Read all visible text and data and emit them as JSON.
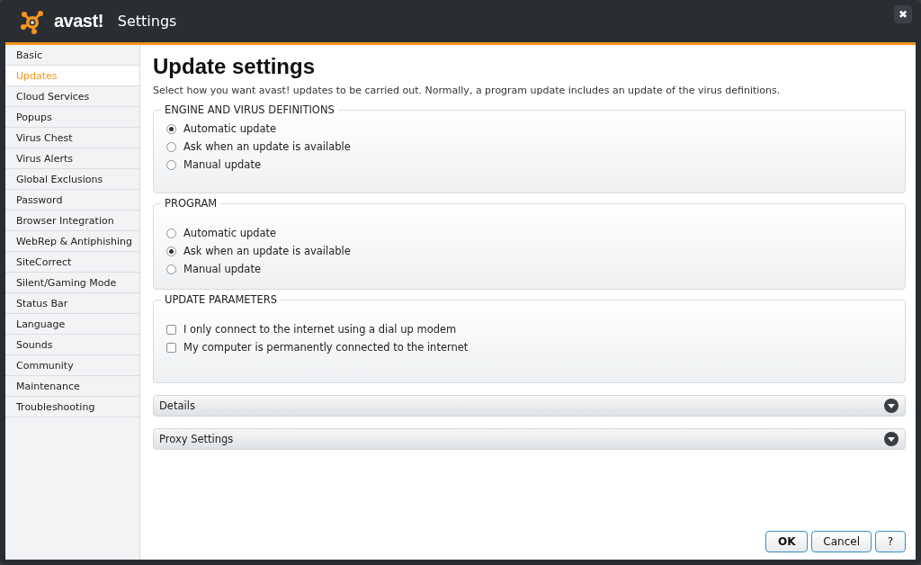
{
  "window": {
    "logo": "avast!",
    "title": "Settings",
    "close": "✖"
  },
  "sidebar": {
    "items": [
      {
        "label": "Basic",
        "selected": false
      },
      {
        "label": "Updates",
        "selected": true
      },
      {
        "label": "Cloud Services",
        "selected": false
      },
      {
        "label": "Popups",
        "selected": false
      },
      {
        "label": "Virus Chest",
        "selected": false
      },
      {
        "label": "Virus Alerts",
        "selected": false
      },
      {
        "label": "Global Exclusions",
        "selected": false
      },
      {
        "label": "Password",
        "selected": false
      },
      {
        "label": "Browser Integration",
        "selected": false
      },
      {
        "label": "WebRep & Antiphishing",
        "selected": false
      },
      {
        "label": "SiteCorrect",
        "selected": false
      },
      {
        "label": "Silent/Gaming Mode",
        "selected": false
      },
      {
        "label": "Status Bar",
        "selected": false
      },
      {
        "label": "Language",
        "selected": false
      },
      {
        "label": "Sounds",
        "selected": false
      },
      {
        "label": "Community",
        "selected": false
      },
      {
        "label": "Maintenance",
        "selected": false
      },
      {
        "label": "Troubleshooting",
        "selected": false
      }
    ]
  },
  "heading": "Update settings",
  "description": "Select how you want avast! updates to be carried out. Normally, a program update includes an update of the virus definitions.",
  "groups": [
    {
      "title": "ENGINE AND VIRUS DEFINITIONS",
      "options": [
        {
          "kind": "radio",
          "label": "Automatic update",
          "selected": true
        },
        {
          "kind": "radio",
          "label": "Ask when an update is available",
          "selected": false
        },
        {
          "kind": "radio",
          "label": "Manual update",
          "selected": false
        }
      ]
    },
    {
      "title": "PROGRAM",
      "options": [
        {
          "kind": "radio",
          "label": "Automatic update",
          "selected": false
        },
        {
          "kind": "radio",
          "label": "Ask when an update is available",
          "selected": true
        },
        {
          "kind": "radio",
          "label": "Manual update",
          "selected": false
        }
      ]
    },
    {
      "title": "UPDATE PARAMETERS",
      "options": [
        {
          "kind": "checkbox",
          "label": "I only connect to the internet using a dial up modem",
          "checked": false
        },
        {
          "kind": "checkbox",
          "label": "My computer is permanently connected to the internet",
          "checked": false
        }
      ]
    }
  ],
  "sections": [
    {
      "label": "Details",
      "expanded": false
    },
    {
      "label": "Proxy Settings",
      "expanded": false
    }
  ],
  "buttons": [
    {
      "label": "OK",
      "default": true
    },
    {
      "label": "Cancel",
      "default": false
    },
    {
      "label": "?",
      "default": false
    }
  ]
}
